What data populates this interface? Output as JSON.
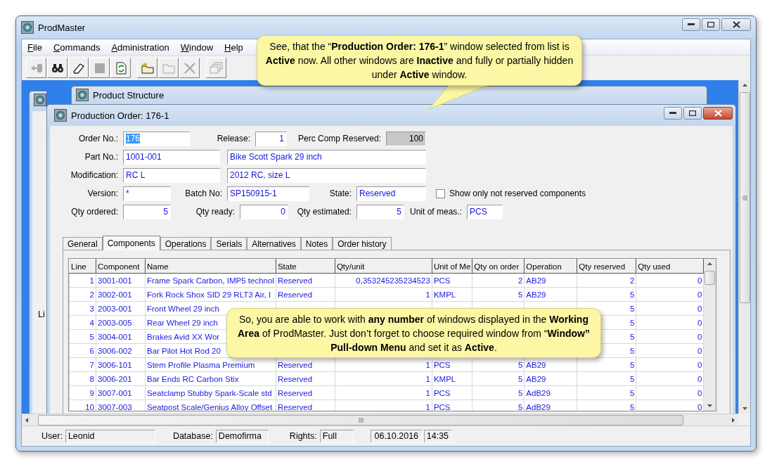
{
  "window": {
    "title": "ProdMaster"
  },
  "menu": [
    "File",
    "Commands",
    "Administration",
    "Window",
    "Help"
  ],
  "toolbar": [
    {
      "kind": "exit",
      "disabled": true
    },
    {
      "kind": "find",
      "disabled": false
    },
    {
      "kind": "eraser",
      "disabled": false
    },
    {
      "kind": "stop",
      "disabled": true
    },
    {
      "kind": "refresh",
      "disabled": false
    },
    {
      "kind": "new",
      "disabled": false
    },
    {
      "kind": "open",
      "disabled": true
    },
    {
      "kind": "delete",
      "disabled": true
    },
    {
      "kind": "windows",
      "disabled": true
    }
  ],
  "behind_window_1": {
    "text": "Li"
  },
  "behind_window_2": {
    "title": "Product Structure"
  },
  "active_window": {
    "title": "Production Order: 176-1",
    "form": {
      "rows": [
        [
          {
            "kind": "field",
            "label": "Order No.:",
            "value": "176",
            "disabled": false,
            "text_selected": true
          },
          {
            "kind": "field",
            "label": "Release:",
            "value": "1",
            "disabled": false,
            "text_selected": false
          },
          {
            "kind": "field",
            "label": "Perc Comp Reserved:",
            "value": "100",
            "disabled": true,
            "text_selected": false
          }
        ],
        [
          {
            "kind": "field",
            "label": "Part No.:",
            "value": "1001-001",
            "disabled": false,
            "text_selected": false
          },
          {
            "kind": "field",
            "value": "Bike Scott Spark 29 inch",
            "disabled": false,
            "text_selected": false
          }
        ],
        [
          {
            "kind": "field",
            "label": "Modification:",
            "value": "RC L",
            "disabled": false,
            "text_selected": false
          },
          {
            "kind": "field",
            "value": "2012 RC, size L",
            "disabled": false,
            "text_selected": false
          }
        ],
        [
          {
            "kind": "field",
            "label": "Version:",
            "value": "*",
            "disabled": false,
            "text_selected": false
          },
          {
            "kind": "field",
            "label": "Batch No:",
            "value": "SP150915-1",
            "disabled": false,
            "text_selected": false
          },
          {
            "kind": "field",
            "label": "State:",
            "value": "Reserved",
            "disabled": false,
            "text_selected": false
          },
          {
            "kind": "checkbox",
            "label": "Show only not reserved components",
            "checked": false
          }
        ],
        [
          {
            "kind": "field",
            "label": "Qty ordered:",
            "value": "5",
            "disabled": false,
            "text_selected": false
          },
          {
            "kind": "field",
            "label": "Qty ready:",
            "value": "0",
            "disabled": false,
            "text_selected": false
          },
          {
            "kind": "field",
            "label": "Qty estimated:",
            "value": "5",
            "disabled": false,
            "text_selected": false
          },
          {
            "kind": "field",
            "label": "Unit of meas.:",
            "value": "PCS",
            "disabled": false,
            "text_selected": false
          }
        ]
      ]
    },
    "tabs": [
      {
        "label": "General",
        "selected": false
      },
      {
        "label": "Components",
        "selected": true
      },
      {
        "label": "Operations",
        "selected": false
      },
      {
        "label": "Serials",
        "selected": false
      },
      {
        "label": "Alternatives",
        "selected": false
      },
      {
        "label": "Notes",
        "selected": false
      },
      {
        "label": "Order history",
        "selected": false
      }
    ],
    "table": {
      "columns": [
        "Line",
        "Component",
        "Name",
        "State",
        "Qty/unit",
        "Unit of Me",
        "Qty on order",
        "Operation",
        "Qty reserved",
        "Qty used"
      ],
      "rows": [
        [
          "1",
          "3001-001",
          "Frame Spark Carbon, IMP5 technol",
          "Reserved",
          "0,353245235234523",
          "PCS",
          "2",
          "AB29",
          "2",
          "0"
        ],
        [
          "2",
          "3002-001",
          "Fork Rock Shox SID 29 RLT3 Air, I",
          "Reserved",
          "1",
          "KMPL",
          "5",
          "AB29",
          "5",
          "0"
        ],
        [
          "3",
          "2003-001",
          "Front Wheel 29 inch",
          null,
          null,
          null,
          null,
          null,
          "5",
          "0"
        ],
        [
          "4",
          "2003-005",
          "Rear Wheel 29 inch",
          null,
          null,
          null,
          null,
          null,
          "5",
          "0"
        ],
        [
          "5",
          "3004-001",
          "Brakes Avid XX Wor",
          null,
          null,
          null,
          null,
          null,
          "5",
          "0"
        ],
        [
          "6",
          "3006-002",
          "Bar Pilot Hot Rod 20",
          null,
          null,
          null,
          null,
          null,
          "5",
          "0"
        ],
        [
          "7",
          "3006-101",
          "Stem Profile Plasma Premium",
          "Reserved",
          "1",
          "PCS",
          "5",
          "AB29",
          "5",
          "0"
        ],
        [
          "8",
          "3006-201",
          "Bar Ends RC Carbon Stix",
          "Reserved",
          "1",
          "KMPL",
          "5",
          "AB29",
          "5",
          "0"
        ],
        [
          "9",
          "3007-001",
          "Seatclamp Stubby Spark-Scale std",
          "Reserved",
          "1",
          "PCS",
          "5",
          "AdB29",
          "5",
          "0"
        ],
        [
          "10",
          "3007-003",
          "Seatpost Scale/Genius Alloy Offset",
          "Reserved",
          "1",
          "PCS",
          "5",
          "AdB29",
          "5",
          "0"
        ]
      ]
    }
  },
  "status_bar": {
    "user": {
      "label": "User:",
      "value": "Leonid"
    },
    "database": {
      "label": "Database:",
      "value": "Demofirma"
    },
    "rights": {
      "label": "Rights:",
      "value": "Full"
    },
    "date": "06.10.2016",
    "time": "14:35"
  },
  "callouts": [
    {
      "kind": "pointer",
      "text": "See, that the “**Production Order: 176-1**” window selected from list is **Active** now.  All other windows are **Inactive** and fully or partially hidden under **Active** window."
    },
    {
      "kind": "plain",
      "text": "So, you are able to work with **any number** of windows displayed in the **Working Area** of ProdMaster.  Just don’t forget to choose required window from “**Window” Pull-down Menu** and set it as **Active**."
    }
  ]
}
